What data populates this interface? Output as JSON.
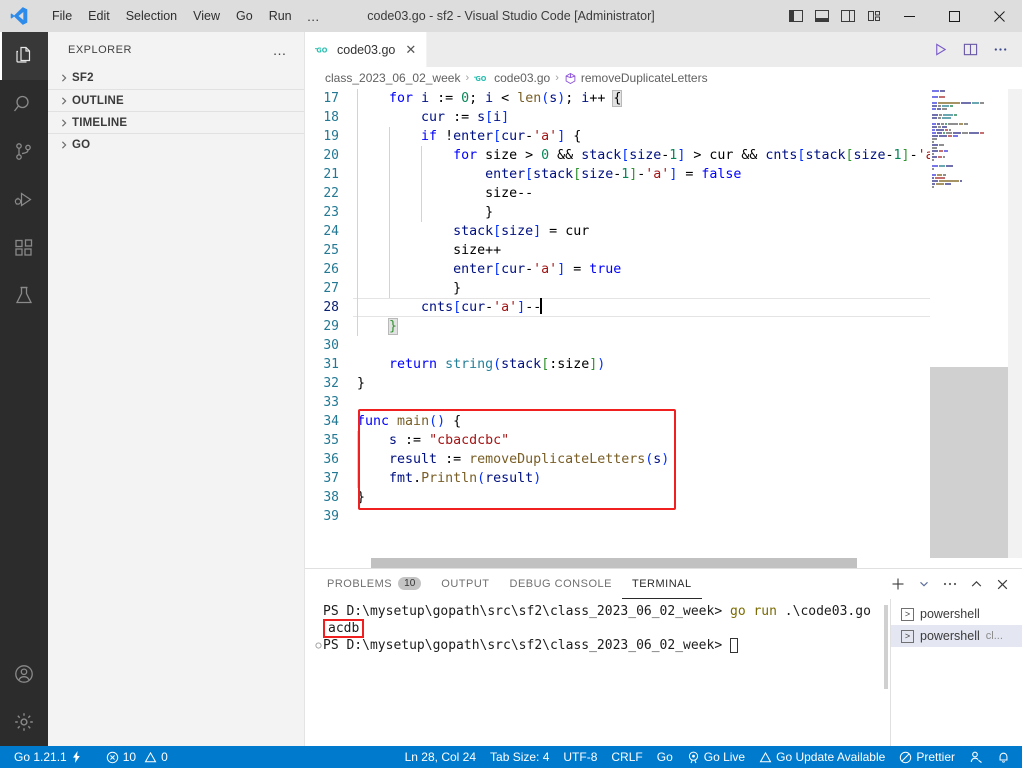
{
  "titlebar": {
    "menus": [
      "File",
      "Edit",
      "Selection",
      "View",
      "Go",
      "Run"
    ],
    "more": "…",
    "title": "code03.go - sf2 - Visual Studio Code [Administrator]",
    "layout_buttons": [
      "toggle-primary-sidebar",
      "toggle-panel",
      "toggle-secondary-sidebar",
      "customize-layout"
    ],
    "window_buttons": {
      "minimize": "─",
      "maximize": "□",
      "close": "✕"
    }
  },
  "activitybar": {
    "items": [
      {
        "name": "explorer",
        "active": true
      },
      {
        "name": "search",
        "active": false
      },
      {
        "name": "source-control",
        "active": false
      },
      {
        "name": "run-and-debug",
        "active": false
      },
      {
        "name": "extensions",
        "active": false
      },
      {
        "name": "testing",
        "active": false
      }
    ],
    "bottom": [
      {
        "name": "accounts"
      },
      {
        "name": "manage-settings"
      }
    ]
  },
  "sidebar": {
    "title": "EXPLORER",
    "more": "…",
    "sections": [
      {
        "label": "SF2",
        "expanded": false
      },
      {
        "label": "OUTLINE",
        "expanded": false
      },
      {
        "label": "TIMELINE",
        "expanded": false
      },
      {
        "label": "GO",
        "expanded": false
      }
    ]
  },
  "editor": {
    "tab": {
      "label": "code03.go",
      "icon": "go-icon",
      "close": "✕"
    },
    "tab_actions": [
      "run-code",
      "split-editor-right",
      "more-actions"
    ],
    "breadcrumb": [
      {
        "label": "class_2023_06_02_week",
        "icon": null
      },
      {
        "label": "code03.go",
        "icon": "go-icon"
      },
      {
        "label": "removeDuplicateLetters",
        "icon": "symbol-method-icon"
      }
    ],
    "separator": "›",
    "first_line_number": 17,
    "current_line": 28,
    "lines": [
      {
        "n": 17,
        "indent": 1,
        "tokens": [
          {
            "t": "for",
            "c": "kw"
          },
          {
            "t": " i ",
            "c": "var"
          },
          {
            "t": ":=",
            "c": "plain"
          },
          {
            "t": " ",
            "c": "plain"
          },
          {
            "t": "0",
            "c": "num"
          },
          {
            "t": "; ",
            "c": "plain"
          },
          {
            "t": "i",
            "c": "var"
          },
          {
            "t": " < ",
            "c": "plain"
          },
          {
            "t": "len",
            "c": "fn"
          },
          {
            "t": "(",
            "c": "brk1"
          },
          {
            "t": "s",
            "c": "var"
          },
          {
            "t": ")",
            "c": "brk1"
          },
          {
            "t": "; ",
            "c": "plain"
          },
          {
            "t": "i",
            "c": "var"
          },
          {
            "t": "++ ",
            "c": "plain"
          },
          {
            "t": "{",
            "c": "hl"
          }
        ]
      },
      {
        "n": 18,
        "indent": 2,
        "tokens": [
          {
            "t": "cur ",
            "c": "var"
          },
          {
            "t": ":= ",
            "c": "plain"
          },
          {
            "t": "s",
            "c": "var"
          },
          {
            "t": "[",
            "c": "brk1"
          },
          {
            "t": "i",
            "c": "var"
          },
          {
            "t": "]",
            "c": "brk1"
          }
        ]
      },
      {
        "n": 19,
        "indent": 2,
        "tokens": [
          {
            "t": "if",
            "c": "kw"
          },
          {
            "t": " !",
            "c": "plain"
          },
          {
            "t": "enter",
            "c": "var"
          },
          {
            "t": "[",
            "c": "brk1"
          },
          {
            "t": "cur",
            "c": "var"
          },
          {
            "t": "-",
            "c": "plain"
          },
          {
            "t": "'a'",
            "c": "str"
          },
          {
            "t": "]",
            "c": "brk1"
          },
          {
            "t": " {",
            "c": "plain"
          }
        ]
      },
      {
        "n": 20,
        "indent": 3,
        "tokens": [
          {
            "t": "for",
            "c": "kw"
          },
          {
            "t": " size > ",
            "c": "plain"
          },
          {
            "t": "0",
            "c": "num"
          },
          {
            "t": " && ",
            "c": "plain"
          },
          {
            "t": "stack",
            "c": "var"
          },
          {
            "t": "[",
            "c": "brk1"
          },
          {
            "t": "size",
            "c": "var"
          },
          {
            "t": "-",
            "c": "plain"
          },
          {
            "t": "1",
            "c": "num"
          },
          {
            "t": "]",
            "c": "brk1"
          },
          {
            "t": " > cur && ",
            "c": "plain"
          },
          {
            "t": "cnts",
            "c": "var"
          },
          {
            "t": "[",
            "c": "brk1"
          },
          {
            "t": "stack",
            "c": "var"
          },
          {
            "t": "[",
            "c": "brk2"
          },
          {
            "t": "size",
            "c": "var"
          },
          {
            "t": "-",
            "c": "plain"
          },
          {
            "t": "1",
            "c": "num"
          },
          {
            "t": "]",
            "c": "brk2"
          },
          {
            "t": "-",
            "c": "plain"
          },
          {
            "t": "'a",
            "c": "str"
          }
        ]
      },
      {
        "n": 21,
        "indent": 4,
        "tokens": [
          {
            "t": "enter",
            "c": "var"
          },
          {
            "t": "[",
            "c": "brk1"
          },
          {
            "t": "stack",
            "c": "var"
          },
          {
            "t": "[",
            "c": "brk2"
          },
          {
            "t": "size",
            "c": "var"
          },
          {
            "t": "-",
            "c": "plain"
          },
          {
            "t": "1",
            "c": "num"
          },
          {
            "t": "]",
            "c": "brk2"
          },
          {
            "t": "-",
            "c": "plain"
          },
          {
            "t": "'a'",
            "c": "str"
          },
          {
            "t": "]",
            "c": "brk1"
          },
          {
            "t": " = ",
            "c": "plain"
          },
          {
            "t": "false",
            "c": "kw"
          }
        ]
      },
      {
        "n": 22,
        "indent": 4,
        "tokens": [
          {
            "t": "size--",
            "c": "plain"
          }
        ]
      },
      {
        "n": 23,
        "indent": 4,
        "tokens": [
          {
            "t": "}",
            "c": "plain"
          }
        ]
      },
      {
        "n": 24,
        "indent": 3,
        "tokens": [
          {
            "t": "stack",
            "c": "var"
          },
          {
            "t": "[",
            "c": "brk1"
          },
          {
            "t": "size",
            "c": "var"
          },
          {
            "t": "]",
            "c": "brk1"
          },
          {
            "t": " = cur",
            "c": "plain"
          }
        ]
      },
      {
        "n": 25,
        "indent": 3,
        "tokens": [
          {
            "t": "size++",
            "c": "plain"
          }
        ]
      },
      {
        "n": 26,
        "indent": 3,
        "tokens": [
          {
            "t": "enter",
            "c": "var"
          },
          {
            "t": "[",
            "c": "brk1"
          },
          {
            "t": "cur",
            "c": "var"
          },
          {
            "t": "-",
            "c": "plain"
          },
          {
            "t": "'a'",
            "c": "str"
          },
          {
            "t": "]",
            "c": "brk1"
          },
          {
            "t": " = ",
            "c": "plain"
          },
          {
            "t": "true",
            "c": "kw"
          }
        ]
      },
      {
        "n": 27,
        "indent": 3,
        "tokens": [
          {
            "t": "}",
            "c": "plain"
          }
        ]
      },
      {
        "n": 28,
        "indent": 2,
        "tokens": [
          {
            "t": "cnts",
            "c": "var"
          },
          {
            "t": "[",
            "c": "brk1"
          },
          {
            "t": "cur",
            "c": "var"
          },
          {
            "t": "-",
            "c": "plain"
          },
          {
            "t": "'a'",
            "c": "str"
          },
          {
            "t": "]",
            "c": "brk1"
          },
          {
            "t": "--",
            "c": "plain"
          }
        ]
      },
      {
        "n": 29,
        "indent": 1,
        "tokens": [
          {
            "t": "}",
            "c": "hl2"
          }
        ]
      },
      {
        "n": 30,
        "indent": 0,
        "tokens": []
      },
      {
        "n": 31,
        "indent": 1,
        "tokens": [
          {
            "t": "return",
            "c": "kw"
          },
          {
            "t": " ",
            "c": "plain"
          },
          {
            "t": "string",
            "c": "type"
          },
          {
            "t": "(",
            "c": "brk1"
          },
          {
            "t": "stack",
            "c": "var"
          },
          {
            "t": "[",
            "c": "brk2"
          },
          {
            "t": ":size",
            "c": "plain"
          },
          {
            "t": "]",
            "c": "brk2"
          },
          {
            "t": ")",
            "c": "brk1"
          }
        ]
      },
      {
        "n": 32,
        "indent": 0,
        "tokens": [
          {
            "t": "}",
            "c": "plain"
          }
        ]
      },
      {
        "n": 33,
        "indent": 0,
        "tokens": []
      },
      {
        "n": 34,
        "indent": 0,
        "tokens": [
          {
            "t": "func",
            "c": "kw"
          },
          {
            "t": " ",
            "c": "plain"
          },
          {
            "t": "main",
            "c": "fn"
          },
          {
            "t": "()",
            "c": "brk1"
          },
          {
            "t": " {",
            "c": "plain"
          }
        ]
      },
      {
        "n": 35,
        "indent": 1,
        "tokens": [
          {
            "t": "s ",
            "c": "var"
          },
          {
            "t": ":= ",
            "c": "plain"
          },
          {
            "t": "\"cbacdcbc\"",
            "c": "str"
          }
        ]
      },
      {
        "n": 36,
        "indent": 1,
        "tokens": [
          {
            "t": "result ",
            "c": "var"
          },
          {
            "t": ":= ",
            "c": "plain"
          },
          {
            "t": "removeDuplicateLetters",
            "c": "fn"
          },
          {
            "t": "(",
            "c": "brk1"
          },
          {
            "t": "s",
            "c": "var"
          },
          {
            "t": ")",
            "c": "brk1"
          }
        ]
      },
      {
        "n": 37,
        "indent": 1,
        "tokens": [
          {
            "t": "fmt",
            "c": "var"
          },
          {
            "t": ".",
            "c": "plain"
          },
          {
            "t": "Println",
            "c": "fn"
          },
          {
            "t": "(",
            "c": "brk1"
          },
          {
            "t": "result",
            "c": "var"
          },
          {
            "t": ")",
            "c": "brk1"
          }
        ]
      },
      {
        "n": 38,
        "indent": 0,
        "tokens": [
          {
            "t": "}",
            "c": "plain"
          }
        ]
      },
      {
        "n": 39,
        "indent": 0,
        "tokens": []
      }
    ],
    "highlight_box": {
      "from_line": 34,
      "to_line": 38,
      "color": "#f02020"
    }
  },
  "panel": {
    "tabs": [
      {
        "label": "PROBLEMS",
        "badge": "10",
        "active": false
      },
      {
        "label": "OUTPUT",
        "badge": null,
        "active": false
      },
      {
        "label": "DEBUG CONSOLE",
        "badge": null,
        "active": false
      },
      {
        "label": "TERMINAL",
        "badge": null,
        "active": true
      }
    ],
    "actions": [
      "new-terminal",
      "terminal-dropdown",
      "more-actions",
      "maximize-panel",
      "close-panel"
    ],
    "terminal": {
      "lines": [
        {
          "type": "command",
          "prompt": "PS D:\\mysetup\\gopath\\src\\sf2\\class_2023_06_02_week>",
          "cmd": "go run",
          "arg": ".\\code03.go",
          "marker": false
        },
        {
          "type": "output",
          "text": "acdb",
          "boxed": true,
          "marker": false
        },
        {
          "type": "prompt",
          "prompt": "PS D:\\mysetup\\gopath\\src\\sf2\\class_2023_06_02_week>",
          "cursor": true,
          "marker": true
        }
      ]
    },
    "terminal_list": [
      {
        "label": "powershell",
        "sub": "",
        "active": false
      },
      {
        "label": "powershell",
        "sub": "cl...",
        "active": true
      }
    ]
  },
  "statusbar": {
    "left": [
      {
        "name": "go-version",
        "label": "Go 1.21.1",
        "icon": "zap-icon"
      },
      {
        "name": "problems",
        "label": "10",
        "icon": "error-icon",
        "label2": "0",
        "icon2": "warning-icon"
      }
    ],
    "right": [
      {
        "name": "cursor-position",
        "label": "Ln 28, Col 24"
      },
      {
        "name": "indentation",
        "label": "Tab Size: 4"
      },
      {
        "name": "encoding",
        "label": "UTF-8"
      },
      {
        "name": "eol",
        "label": "CRLF"
      },
      {
        "name": "language-mode",
        "label": "Go"
      },
      {
        "name": "go-live",
        "label": "Go Live",
        "icon": "broadcast-icon"
      },
      {
        "name": "go-update",
        "label": "Go Update Available",
        "icon": "warning-icon"
      },
      {
        "name": "prettier",
        "label": "Prettier",
        "icon": "no-entry-icon"
      },
      {
        "name": "remote",
        "label": "",
        "icon": "account-icon"
      },
      {
        "name": "notifications",
        "label": "",
        "icon": "bell-icon"
      }
    ]
  },
  "colors": {
    "accent": "#007acc",
    "highlight": "#f02020",
    "titlebar_bg": "#dddddd",
    "sidebar_bg": "#f3f3f3",
    "activitybar_bg": "#2c2c2c",
    "editor_bg": "#ffffff"
  }
}
